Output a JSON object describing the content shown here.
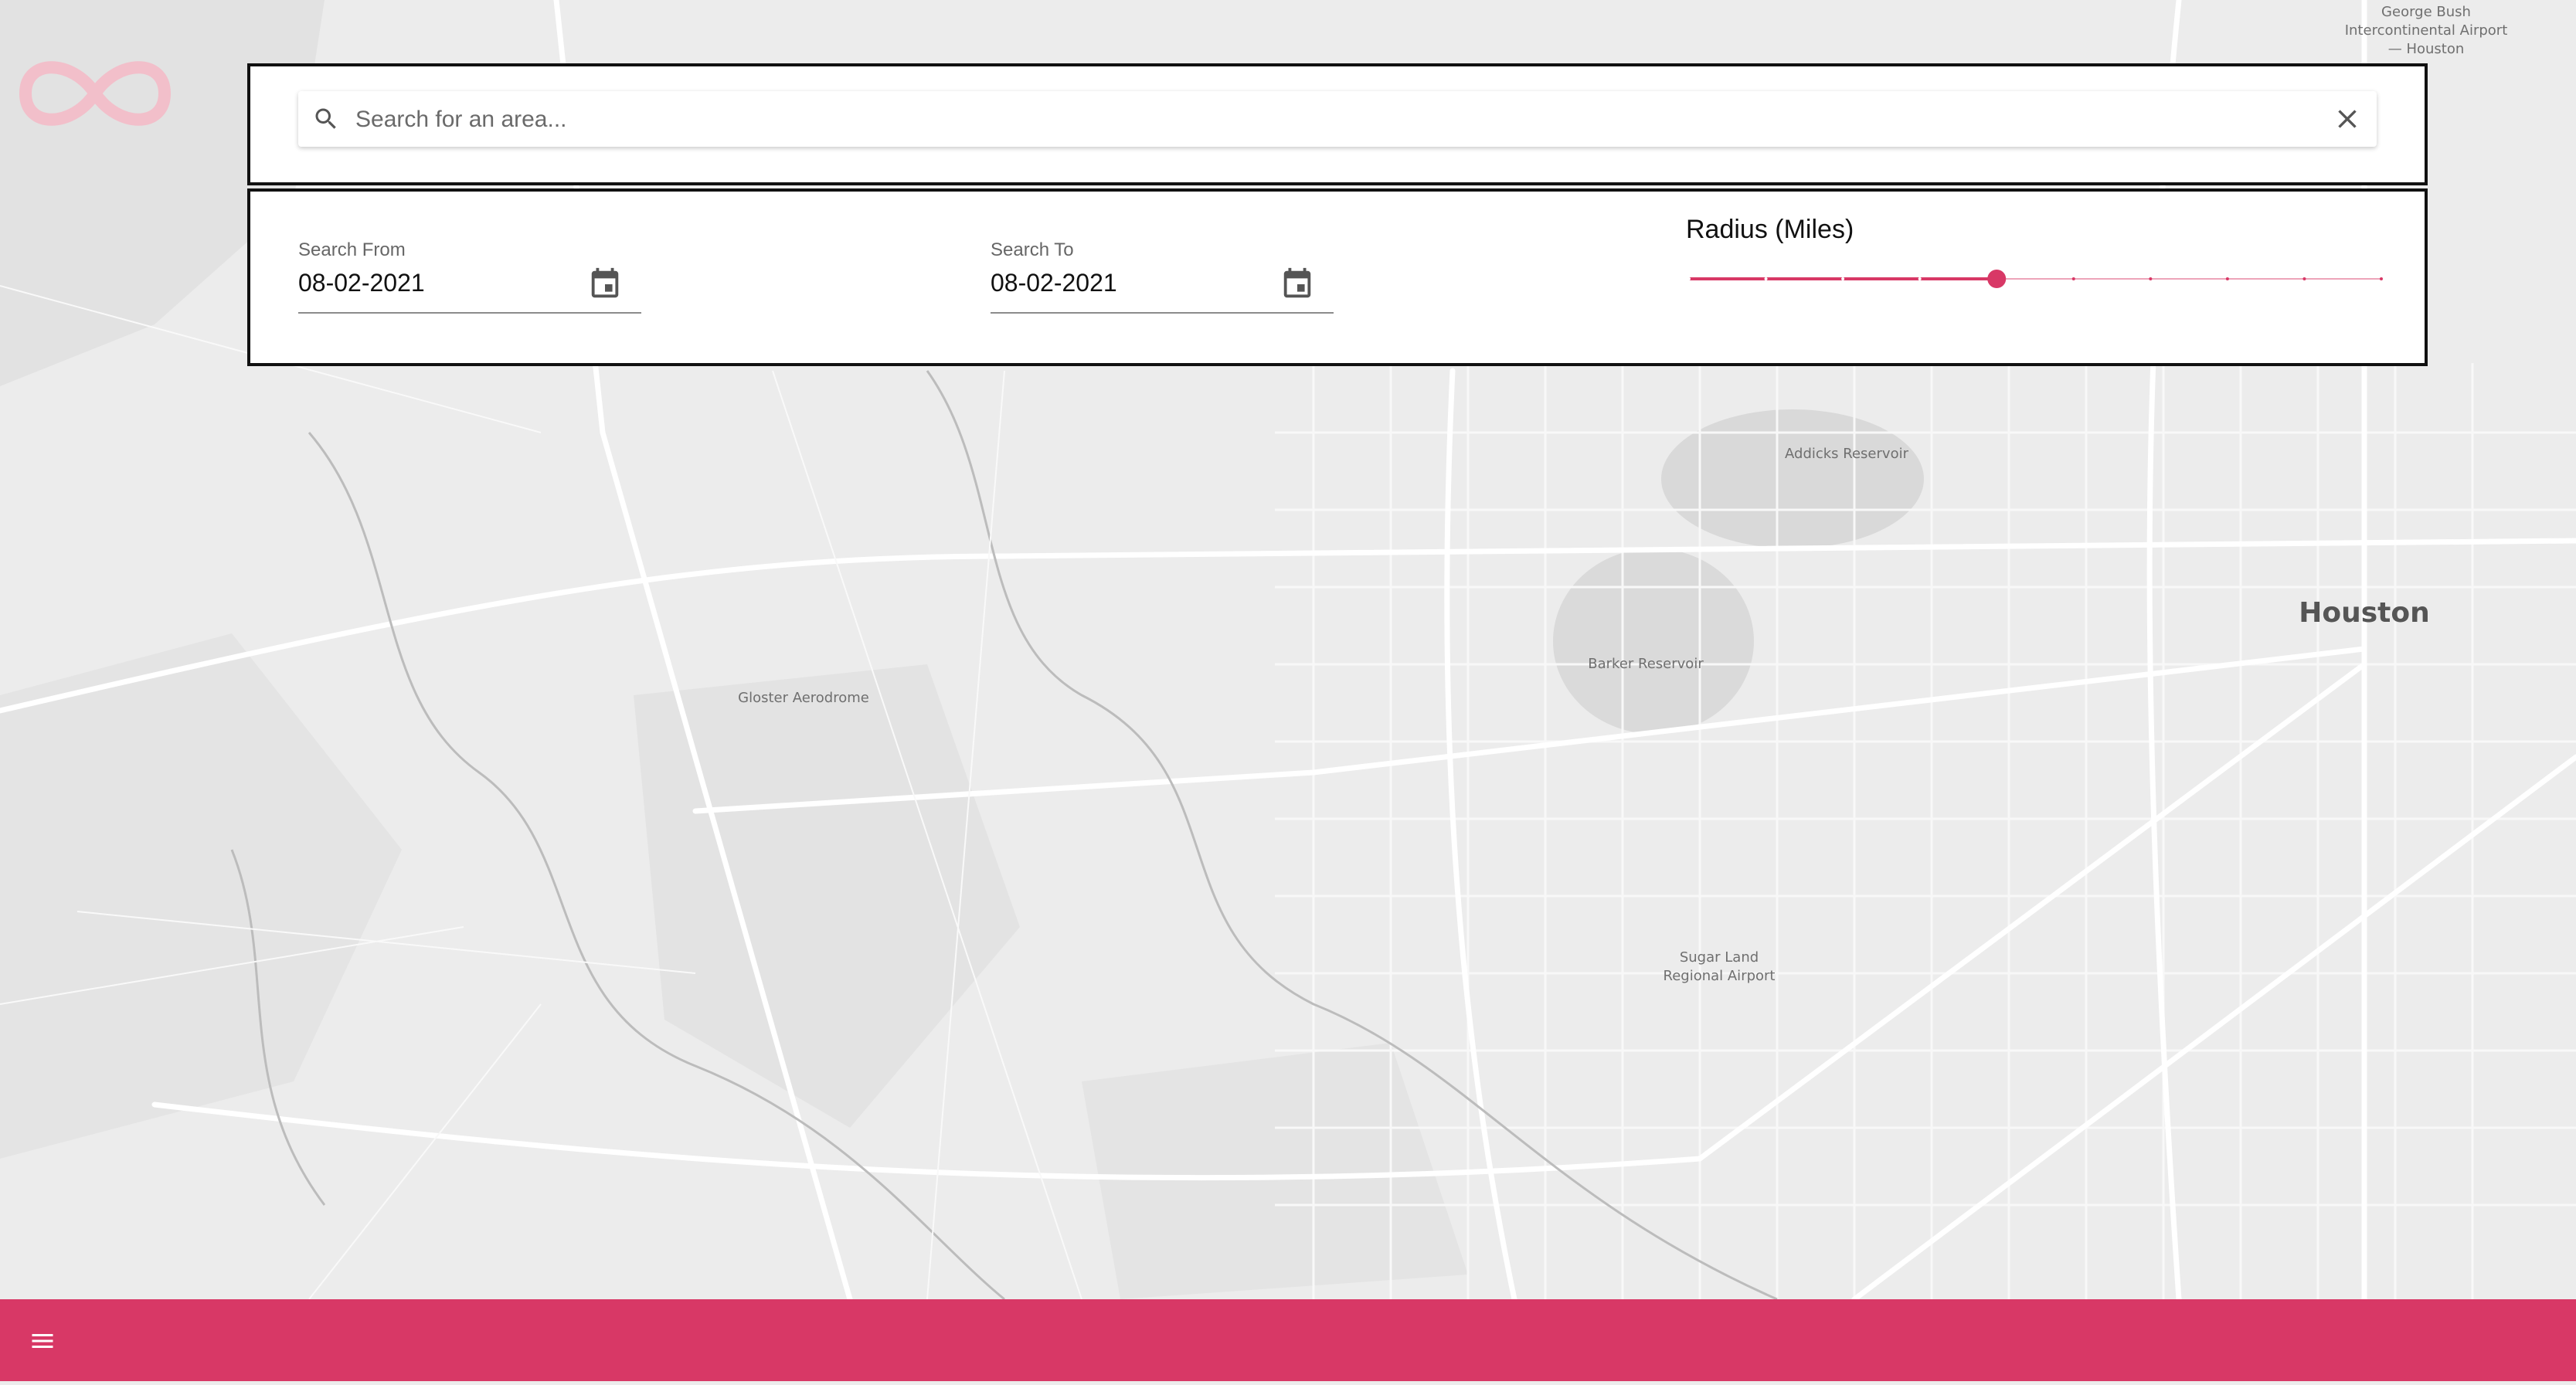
{
  "theme": {
    "accent": "#d83866",
    "map_background": "#ececec",
    "panel_border": "#111111"
  },
  "logo": {
    "icon": "infinity-logo-icon"
  },
  "search": {
    "placeholder": "Search for an area...",
    "value": "",
    "search_icon": "search-icon",
    "clear_icon": "close-icon"
  },
  "filters": {
    "search_from": {
      "label": "Search From",
      "value": "08-02-2021",
      "icon": "calendar-icon"
    },
    "search_to": {
      "label": "Search To",
      "value": "08-02-2021",
      "icon": "calendar-icon"
    },
    "radius": {
      "label": "Radius (Miles)",
      "steps": 10,
      "selected_step": 4
    }
  },
  "map": {
    "labels": {
      "airport_iah": "George Bush Intercontinental Airport — Houston",
      "addicks": "Addicks Reservoir",
      "houston": "Houston",
      "barker": "Barker Reservoir",
      "gloster": "Gloster Aerodrome",
      "sugar_land": "Sugar Land Regional Airport"
    }
  },
  "bottom_bar": {
    "menu_icon": "hamburger-menu-icon"
  }
}
